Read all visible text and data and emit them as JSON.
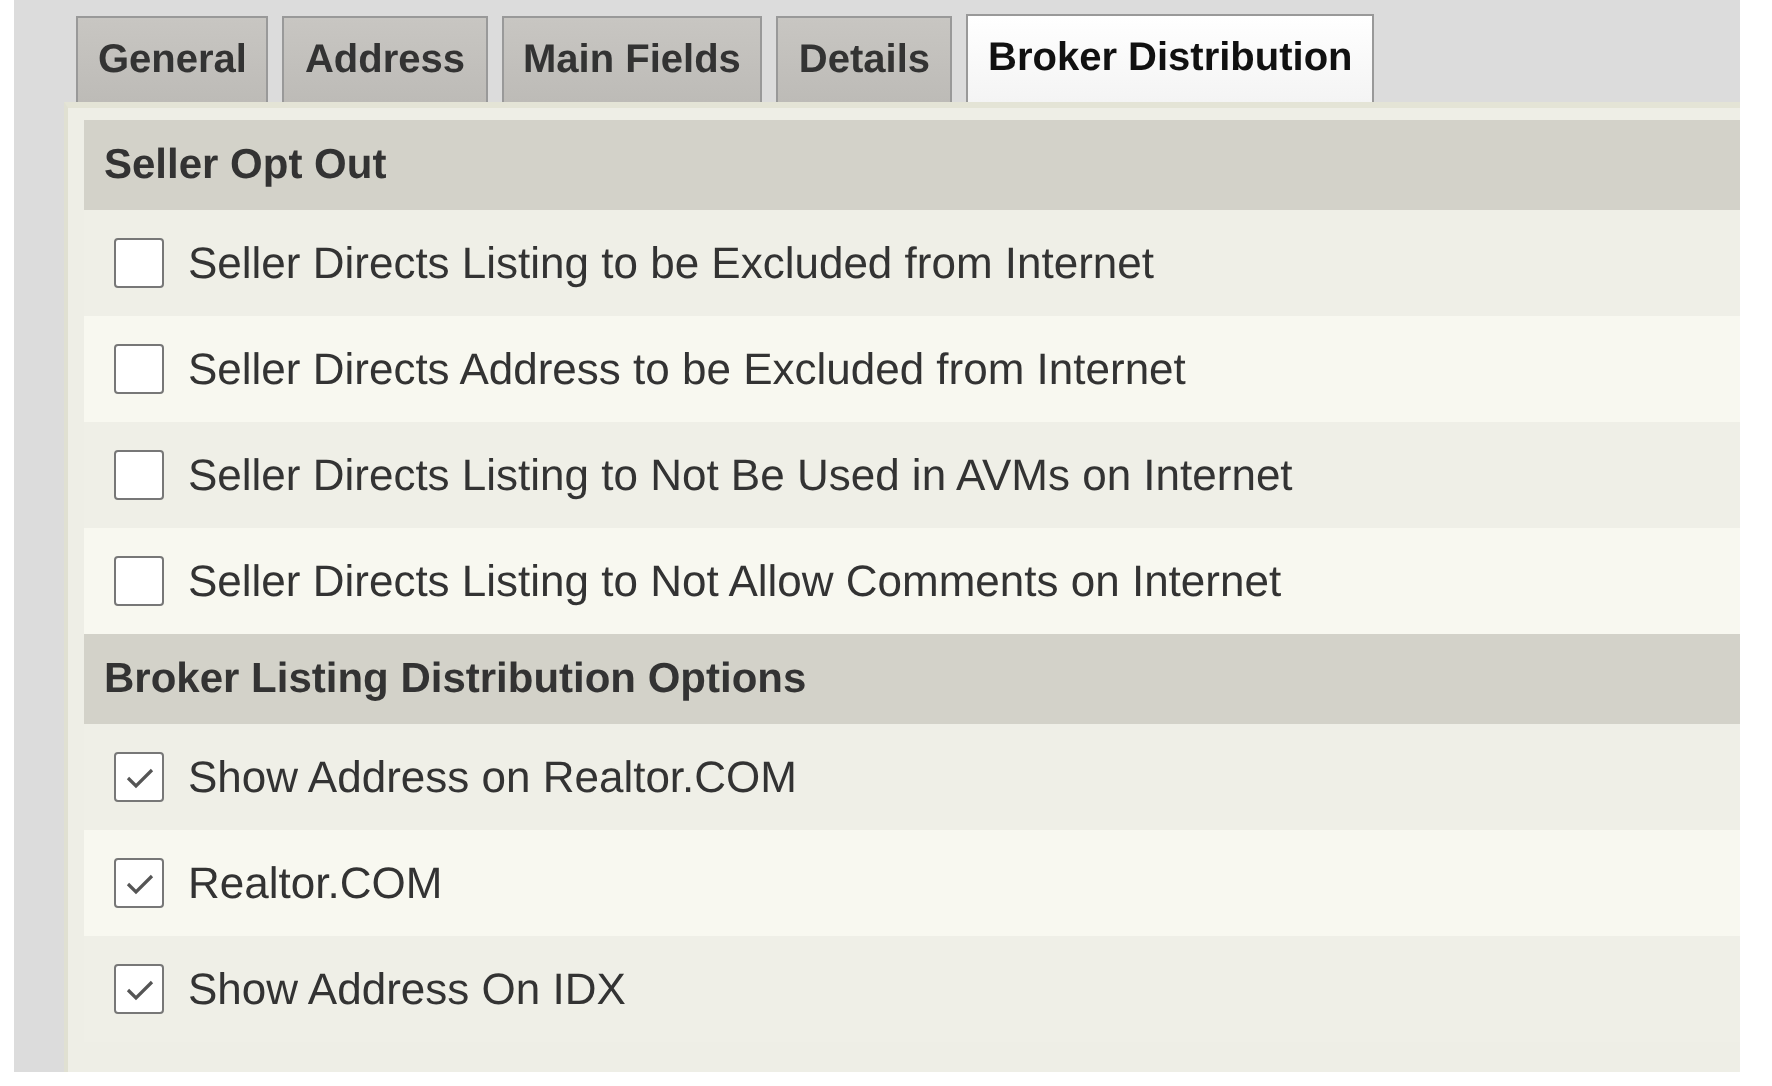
{
  "tabs": [
    {
      "label": "General",
      "selected": false
    },
    {
      "label": "Address",
      "selected": false
    },
    {
      "label": "Main Fields",
      "selected": false
    },
    {
      "label": "Details",
      "selected": false
    },
    {
      "label": "Broker Distribution",
      "selected": true
    }
  ],
  "sections": [
    {
      "title": "Seller Opt Out",
      "options": [
        {
          "label": "Seller Directs Listing to be Excluded from Internet",
          "checked": false
        },
        {
          "label": "Seller Directs Address to be Excluded from Internet",
          "checked": false
        },
        {
          "label": "Seller Directs Listing to Not Be Used in AVMs on Internet",
          "checked": false
        },
        {
          "label": "Seller Directs Listing to Not Allow Comments on Internet",
          "checked": false
        }
      ]
    },
    {
      "title": "Broker Listing Distribution Options",
      "options": [
        {
          "label": "Show Address on Realtor.COM",
          "checked": true
        },
        {
          "label": "Realtor.COM",
          "checked": true
        },
        {
          "label": "Show Address On IDX",
          "checked": true
        }
      ]
    }
  ]
}
